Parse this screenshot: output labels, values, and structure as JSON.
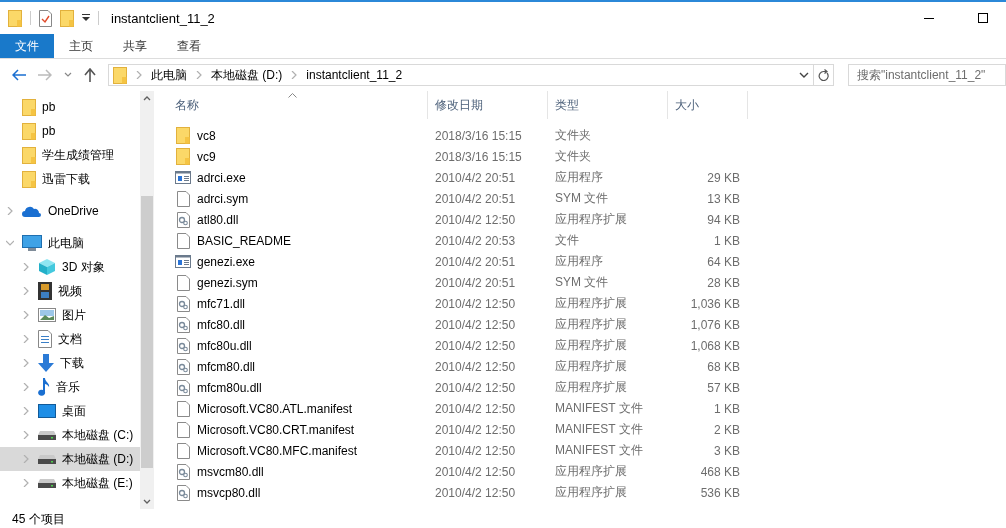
{
  "window": {
    "title": "instantclient_11_2"
  },
  "ribbon_tabs": [
    {
      "label": "文件",
      "selected": true
    },
    {
      "label": "主页",
      "selected": false
    },
    {
      "label": "共享",
      "selected": false
    },
    {
      "label": "查看",
      "selected": false
    }
  ],
  "address_bar": {
    "crumbs": [
      "此电脑",
      "本地磁盘 (D:)",
      "instantclient_11_2"
    ]
  },
  "search": {
    "placeholder": "搜索\"instantclient_11_2\""
  },
  "sidebar": {
    "items": [
      {
        "label": "pb",
        "kind": "folder",
        "selected": false
      },
      {
        "label": "pb",
        "kind": "folder",
        "selected": false
      },
      {
        "label": "学生成绩管理",
        "kind": "folder",
        "selected": false
      },
      {
        "label": "迅雷下载",
        "kind": "folder",
        "selected": false
      },
      {
        "label": "OneDrive",
        "kind": "cloud",
        "selected": false,
        "expanded": false
      },
      {
        "label": "此电脑",
        "kind": "pc",
        "selected": false,
        "expanded": true,
        "children": [
          {
            "label": "3D 对象",
            "kind": "cube",
            "selected": false,
            "expanded": false
          },
          {
            "label": "视频",
            "kind": "video",
            "selected": false,
            "expanded": false
          },
          {
            "label": "图片",
            "kind": "image",
            "selected": false,
            "expanded": false
          },
          {
            "label": "文档",
            "kind": "doc",
            "selected": false,
            "expanded": false
          },
          {
            "label": "下载",
            "kind": "download",
            "selected": false,
            "expanded": false
          },
          {
            "label": "音乐",
            "kind": "music",
            "selected": false,
            "expanded": false
          },
          {
            "label": "桌面",
            "kind": "desktop",
            "selected": false,
            "expanded": false
          },
          {
            "label": "本地磁盘 (C:)",
            "kind": "drive",
            "selected": false,
            "expanded": false
          },
          {
            "label": "本地磁盘 (D:)",
            "kind": "drive",
            "selected": true,
            "expanded": false
          },
          {
            "label": "本地磁盘 (E:)",
            "kind": "drive",
            "selected": false,
            "expanded": false
          }
        ]
      }
    ]
  },
  "table": {
    "columns": [
      "名称",
      "修改日期",
      "类型",
      "大小"
    ],
    "rows": [
      {
        "kind": "folder",
        "name": "vc8",
        "date": "2018/3/16 15:15",
        "type": "文件夹"
      },
      {
        "kind": "folder",
        "name": "vc9",
        "date": "2018/3/16 15:15",
        "type": "文件夹"
      },
      {
        "kind": "exe",
        "name": "adrci.exe",
        "date": "2010/4/2 20:51",
        "type": "应用程序",
        "size": "29 KB"
      },
      {
        "kind": "file",
        "name": "adrci.sym",
        "date": "2010/4/2 20:51",
        "type": "SYM 文件",
        "size": "13 KB"
      },
      {
        "kind": "dll",
        "name": "atl80.dll",
        "date": "2010/4/2 12:50",
        "type": "应用程序扩展",
        "size": "94 KB"
      },
      {
        "kind": "file",
        "name": "BASIC_README",
        "date": "2010/4/2 20:53",
        "type": "文件",
        "size": "1 KB"
      },
      {
        "kind": "exe",
        "name": "genezi.exe",
        "date": "2010/4/2 20:51",
        "type": "应用程序",
        "size": "64 KB"
      },
      {
        "kind": "file",
        "name": "genezi.sym",
        "date": "2010/4/2 20:51",
        "type": "SYM 文件",
        "size": "28 KB"
      },
      {
        "kind": "dll",
        "name": "mfc71.dll",
        "date": "2010/4/2 12:50",
        "type": "应用程序扩展",
        "size": "1,036 KB"
      },
      {
        "kind": "dll",
        "name": "mfc80.dll",
        "date": "2010/4/2 12:50",
        "type": "应用程序扩展",
        "size": "1,076 KB"
      },
      {
        "kind": "dll",
        "name": "mfc80u.dll",
        "date": "2010/4/2 12:50",
        "type": "应用程序扩展",
        "size": "1,068 KB"
      },
      {
        "kind": "dll",
        "name": "mfcm80.dll",
        "date": "2010/4/2 12:50",
        "type": "应用程序扩展",
        "size": "68 KB"
      },
      {
        "kind": "dll",
        "name": "mfcm80u.dll",
        "date": "2010/4/2 12:50",
        "type": "应用程序扩展",
        "size": "57 KB"
      },
      {
        "kind": "file",
        "name": "Microsoft.VC80.ATL.manifest",
        "date": "2010/4/2 12:50",
        "type": "MANIFEST 文件",
        "size": "1 KB"
      },
      {
        "kind": "file",
        "name": "Microsoft.VC80.CRT.manifest",
        "date": "2010/4/2 12:50",
        "type": "MANIFEST 文件",
        "size": "2 KB"
      },
      {
        "kind": "file",
        "name": "Microsoft.VC80.MFC.manifest",
        "date": "2010/4/2 12:50",
        "type": "MANIFEST 文件",
        "size": "3 KB"
      },
      {
        "kind": "dll",
        "name": "msvcm80.dll",
        "date": "2010/4/2 12:50",
        "type": "应用程序扩展",
        "size": "468 KB"
      },
      {
        "kind": "dll",
        "name": "msvcp80.dll",
        "date": "2010/4/2 12:50",
        "type": "应用程序扩展",
        "size": "536 KB"
      }
    ]
  },
  "status_bar": {
    "count": "45 个项目"
  }
}
